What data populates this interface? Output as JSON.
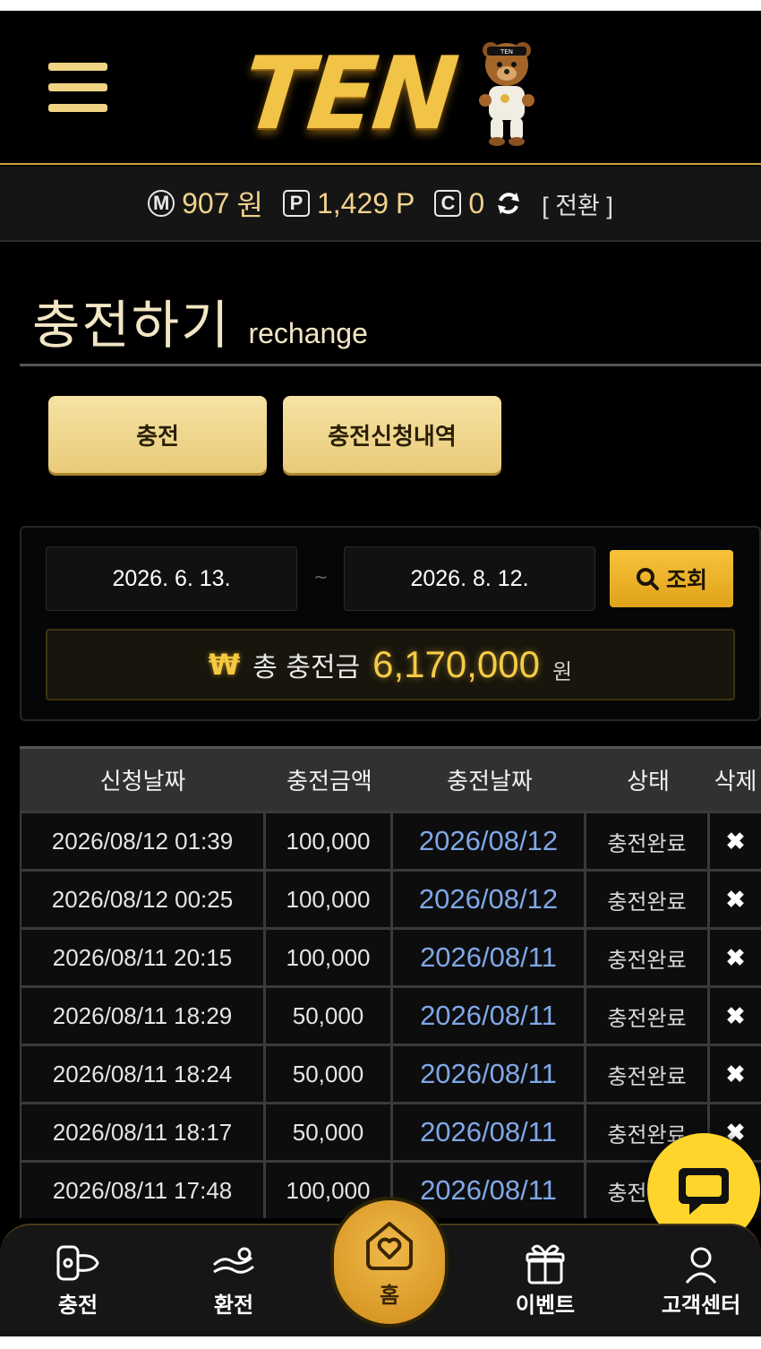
{
  "header": {
    "logo_text": "TEN",
    "bear_cap_text": "TEN"
  },
  "balance": {
    "money_badge": "M",
    "money_value": "907",
    "money_unit": "원",
    "point_badge": "P",
    "point_value": "1,429",
    "point_unit": "P",
    "coin_badge": "C",
    "coin_value": "0",
    "switch_label": "[ 전환 ]"
  },
  "page": {
    "title": "충전하기",
    "subtitle": "rechange"
  },
  "tabs": {
    "charge": "충전",
    "history": "충전신청내역"
  },
  "search": {
    "date_from": "2026. 6. 13.",
    "separator": "~",
    "date_to": "2026. 8. 12.",
    "button_label": "조회"
  },
  "total": {
    "symbol": "₩",
    "label": "총 충전금",
    "amount": "6,170,000",
    "unit": "원"
  },
  "table": {
    "headers": [
      "신청날짜",
      "충전금액",
      "충전날짜",
      "상태",
      "삭제"
    ],
    "rows": [
      {
        "requested": "2026/08/12 01:39",
        "amount": "100,000",
        "charged": "2026/08/12",
        "status": "충전완료",
        "delete": "✖"
      },
      {
        "requested": "2026/08/12 00:25",
        "amount": "100,000",
        "charged": "2026/08/12",
        "status": "충전완료",
        "delete": "✖"
      },
      {
        "requested": "2026/08/11 20:15",
        "amount": "100,000",
        "charged": "2026/08/11",
        "status": "충전완료",
        "delete": "✖"
      },
      {
        "requested": "2026/08/11 18:29",
        "amount": "50,000",
        "charged": "2026/08/11",
        "status": "충전완료",
        "delete": "✖"
      },
      {
        "requested": "2026/08/11 18:24",
        "amount": "50,000",
        "charged": "2026/08/11",
        "status": "충전완료",
        "delete": "✖"
      },
      {
        "requested": "2026/08/11 18:17",
        "amount": "50,000",
        "charged": "2026/08/11",
        "status": "충전완료",
        "delete": "✖"
      },
      {
        "requested": "2026/08/11 17:48",
        "amount": "100,000",
        "charged": "2026/08/11",
        "status": "충전완료",
        "delete": "✖"
      }
    ]
  },
  "bottom_nav": {
    "charge": "충전",
    "exchange": "환전",
    "home": "홈",
    "event": "이벤트",
    "support": "고객센터"
  },
  "colors": {
    "gold": "#f1c448",
    "tab_gold": "#f6e3a4",
    "link_blue": "#7fa8e8",
    "chat_yellow": "#ffd52c"
  }
}
